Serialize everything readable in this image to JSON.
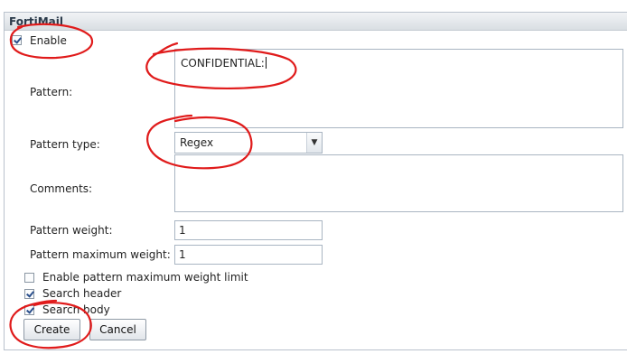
{
  "window": {
    "title": "FortiMail"
  },
  "form": {
    "enable": {
      "label": "Enable",
      "checked": true
    },
    "pattern": {
      "label": "Pattern:",
      "value": "CONFIDENTIAL:"
    },
    "pattern_type": {
      "label": "Pattern type:",
      "value": "Regex"
    },
    "comments": {
      "label": "Comments:",
      "value": ""
    },
    "pattern_weight": {
      "label": "Pattern weight:",
      "value": "1"
    },
    "pattern_max_weight": {
      "label": "Pattern maximum weight:",
      "value": "1"
    },
    "enable_max_weight_limit": {
      "label": "Enable pattern maximum weight limit",
      "checked": false
    },
    "search_header": {
      "label": "Search header",
      "checked": true
    },
    "search_body": {
      "label": "Search body",
      "checked": true
    }
  },
  "buttons": {
    "create": "Create",
    "cancel": "Cancel"
  },
  "annotation_color": "#e01b1b"
}
